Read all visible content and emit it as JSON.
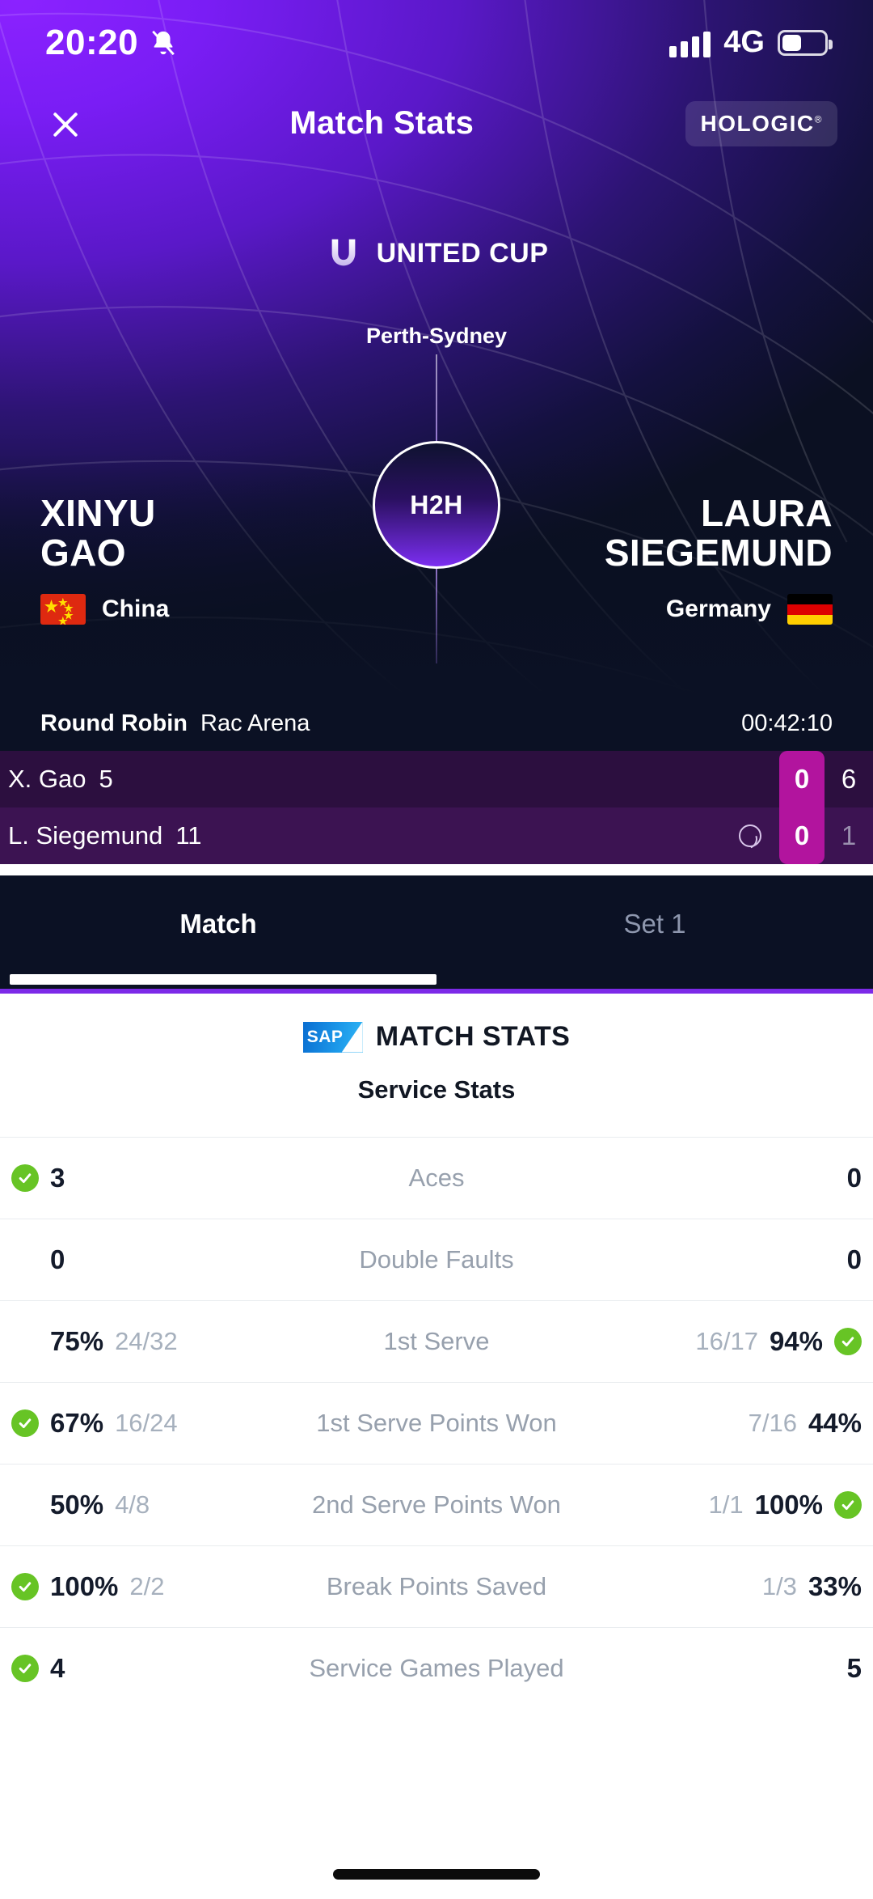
{
  "status_bar": {
    "time": "20:20",
    "mute_icon": "bell-muted-icon",
    "network": "4G",
    "signal_icon": "signal-bars-icon",
    "battery_icon": "battery-icon"
  },
  "header": {
    "close_icon": "close-icon",
    "title": "Match Stats",
    "sponsor": "HOLOGIC"
  },
  "tournament": {
    "logo_icon": "united-cup-logo-icon",
    "name": "UNITED CUP",
    "venue": "Perth-Sydney"
  },
  "h2h": {
    "label": "H2H"
  },
  "players": {
    "left": {
      "first_name": "XINYU",
      "last_name": "GAO",
      "country": "China",
      "flag_icon": "china-flag-icon"
    },
    "right": {
      "first_name": "LAURA",
      "last_name": "SIEGEMUND",
      "country": "Germany",
      "flag_icon": "germany-flag-icon"
    }
  },
  "match_meta": {
    "round": "Round Robin",
    "arena": "Rac Arena",
    "elapsed": "00:42:10"
  },
  "scoreboard": {
    "rows": [
      {
        "name": "X. Gao",
        "rank": "5",
        "serving": false,
        "current_game": "0",
        "sets": [
          "6"
        ],
        "set_dim": false
      },
      {
        "name": "L. Siegemund",
        "rank": "11",
        "serving": true,
        "serve_icon": "tennis-ball-icon",
        "current_game": "0",
        "sets": [
          "1"
        ],
        "set_dim": true
      }
    ]
  },
  "tabs": [
    {
      "label": "Match",
      "active": true
    },
    {
      "label": "Set 1",
      "active": false
    }
  ],
  "stats_panel": {
    "brand_logo": "sap-logo-icon",
    "brand_title": "MATCH STATS",
    "section_title": "Service Stats",
    "rows": [
      {
        "label": "Aces",
        "left_value": "3",
        "left_frac": "",
        "left_win": true,
        "right_value": "0",
        "right_frac": "",
        "right_win": false
      },
      {
        "label": "Double Faults",
        "left_value": "0",
        "left_frac": "",
        "left_win": false,
        "right_value": "0",
        "right_frac": "",
        "right_win": false
      },
      {
        "label": "1st Serve",
        "left_value": "75%",
        "left_frac": "24/32",
        "left_win": false,
        "right_value": "94%",
        "right_frac": "16/17",
        "right_win": true
      },
      {
        "label": "1st Serve Points Won",
        "left_value": "67%",
        "left_frac": "16/24",
        "left_win": true,
        "right_value": "44%",
        "right_frac": "7/16",
        "right_win": false
      },
      {
        "label": "2nd Serve Points Won",
        "left_value": "50%",
        "left_frac": "4/8",
        "left_win": false,
        "right_value": "100%",
        "right_frac": "1/1",
        "right_win": true
      },
      {
        "label": "Break Points Saved",
        "left_value": "100%",
        "left_frac": "2/2",
        "left_win": true,
        "right_value": "33%",
        "right_frac": "1/3",
        "right_win": false
      },
      {
        "label": "Service Games Played",
        "left_value": "4",
        "left_frac": "",
        "left_win": true,
        "right_value": "5",
        "right_frac": "",
        "right_win": false
      }
    ]
  },
  "colors": {
    "brand_purple": "#7c2ae8",
    "score_accent": "#b2149e",
    "win_green": "#67c425",
    "panel_bg": "#0b1124"
  }
}
